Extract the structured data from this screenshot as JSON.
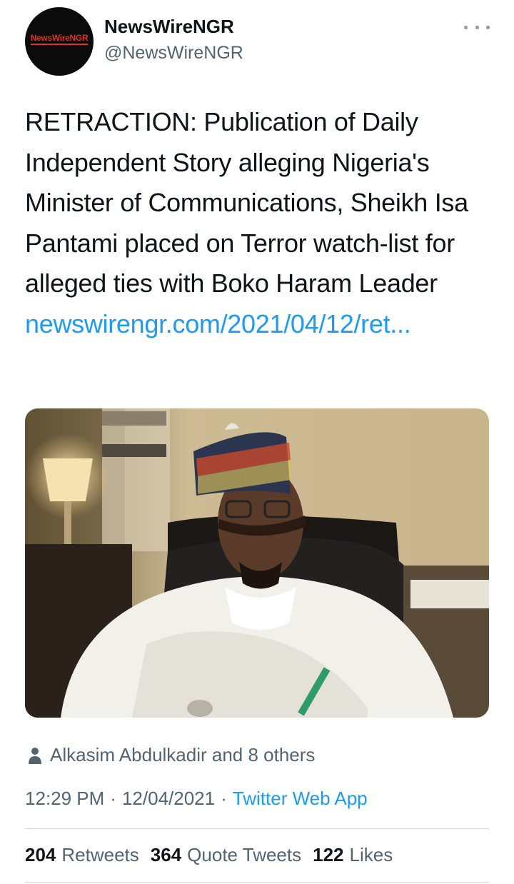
{
  "account": {
    "avatar_text": "NewsWireNGR",
    "display_name": "NewsWireNGR",
    "handle": "@NewsWireNGR",
    "more_icon": "more-horizontal-icon"
  },
  "tweet": {
    "text": "RETRACTION: Publication of Daily Independent Story alleging Nigeria's Minister of Communications, Sheikh Isa Pantami placed on Terror watch-list for alleged ties with Boko Haram Leader ",
    "link": "newswirengr.com/2021/04/12/ret...",
    "media_icon": "photo"
  },
  "liked_by": {
    "icon": "person-icon",
    "text": "Alkasim Abdulkadir and 8 others"
  },
  "meta": {
    "time": "12:29 PM",
    "separator": "·",
    "date": "12/04/2021",
    "source": "Twitter Web App"
  },
  "stats": {
    "retweets_count": "204",
    "retweets_label": "Retweets",
    "quotes_count": "364",
    "quotes_label": "Quote Tweets",
    "likes_count": "122",
    "likes_label": "Likes"
  },
  "colors": {
    "link": "#1d9bf0",
    "secondary_text": "#536471",
    "brand_red": "#e0302a"
  }
}
